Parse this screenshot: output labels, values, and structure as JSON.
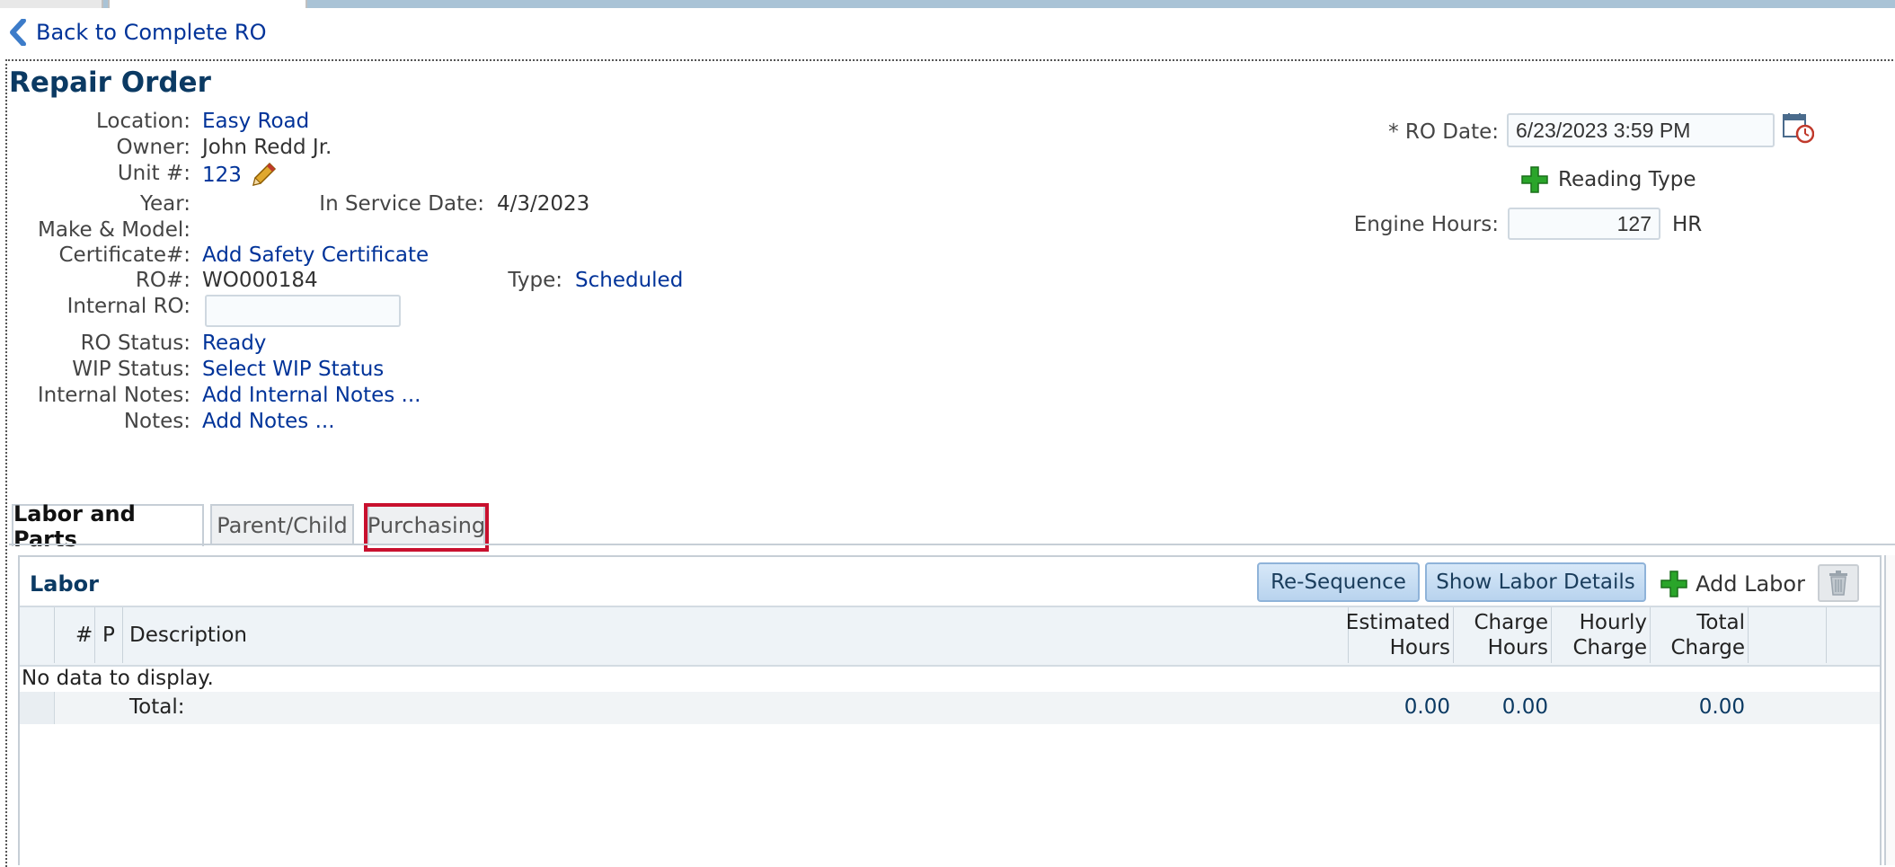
{
  "back_link": "Back to Complete RO",
  "title": "Repair Order",
  "fields": {
    "location_label": "Location:",
    "location": "Easy Road",
    "owner_label": "Owner:",
    "owner": "John Redd Jr.",
    "unit_label": "Unit #:",
    "unit": "123",
    "year_label": "Year:",
    "in_service_label": "In Service Date:",
    "in_service": "4/3/2023",
    "make_label": "Make & Model:",
    "cert_label": "Certificate#:",
    "cert": "Add Safety Certificate",
    "ro_label": "RO#:",
    "ro": "WO000184",
    "type_label": "Type:",
    "type": "Scheduled",
    "internal_ro_label": "Internal RO:",
    "internal_ro": "",
    "ro_status_label": "RO Status:",
    "ro_status": "Ready",
    "wip_label": "WIP Status:",
    "wip": "Select WIP Status",
    "internal_notes_label": "Internal Notes:",
    "internal_notes": "Add Internal Notes ...",
    "notes_label": "Notes:",
    "notes": "Add Notes ..."
  },
  "right": {
    "ro_date_label": "* RO Date:",
    "ro_date": "6/23/2023 3:59 PM",
    "reading_type": "Reading Type",
    "engine_label": "Engine Hours:",
    "engine_value": "127",
    "engine_unit": "HR"
  },
  "tabs": [
    "Labor and Parts",
    "Parent/Child",
    "Purchasing"
  ],
  "labor": {
    "title": "Labor",
    "resequence": "Re-Sequence",
    "show_details": "Show Labor Details",
    "add_labor": "Add Labor",
    "columns": {
      "num": "#",
      "p": "P",
      "description": "Description",
      "est_hours": "Estimated Hours",
      "charge_hours": "Charge Hours",
      "hourly_charge": "Hourly Charge",
      "total_charge": "Total Charge"
    },
    "no_data": "No data to display.",
    "total_label": "Total:",
    "totals": {
      "est_hours": "0.00",
      "charge_hours": "0.00",
      "total_charge": "0.00"
    }
  },
  "colors": {
    "link": "#003399",
    "title": "#0b3a63",
    "highlight": "#c8102e",
    "add_green": "#2aa52a"
  }
}
